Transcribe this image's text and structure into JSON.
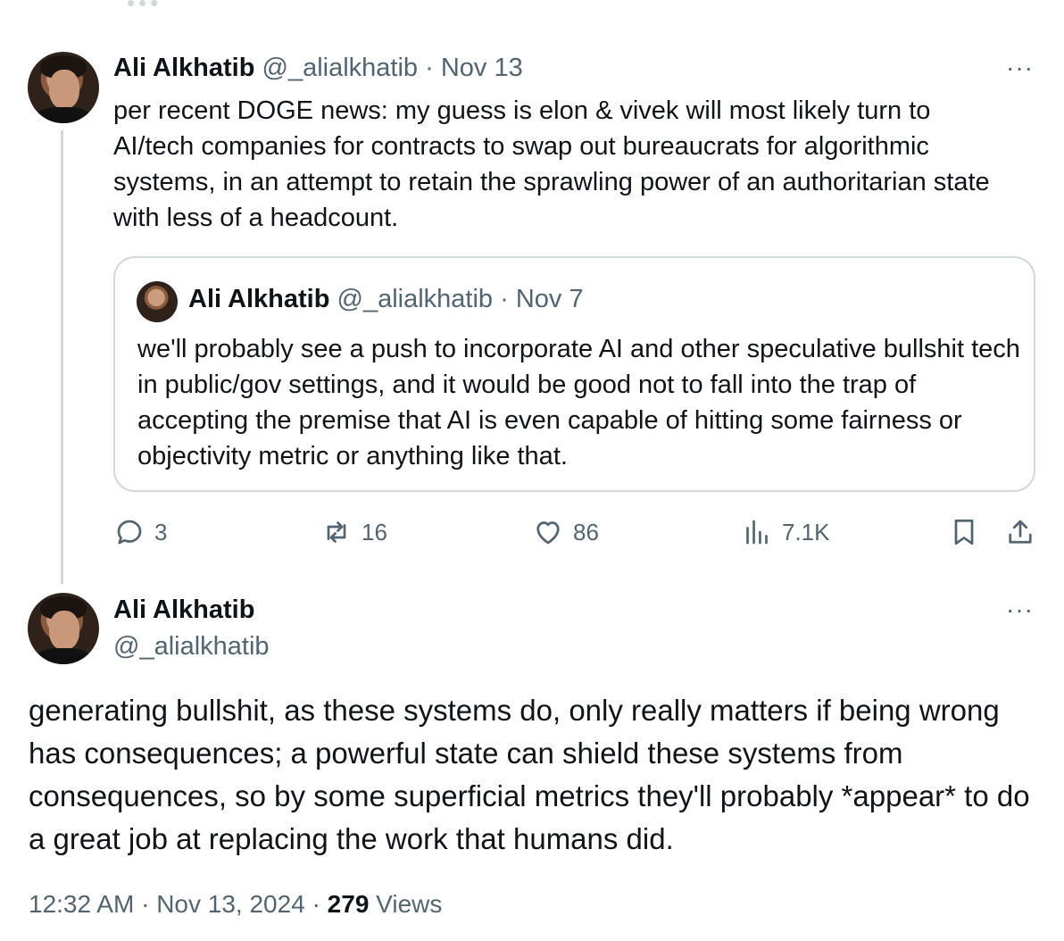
{
  "thread": {
    "first_tweet": {
      "name": "Ali Alkhatib",
      "handle": "@_alialkhatib",
      "separator": "·",
      "date": "Nov 13",
      "more": "···",
      "text": "per recent DOGE news: my guess is elon & vivek will most likely turn to AI/tech companies for contracts to swap out bureaucrats for algorithmic systems, in an attempt to retain the sprawling power of an authoritarian state with less of a headcount.",
      "quoted": {
        "name": "Ali Alkhatib",
        "handle": "@_alialkhatib",
        "separator": "·",
        "date": "Nov 7",
        "text": "we'll probably see a push to incorporate AI and other speculative bullshit tech in public/gov settings, and it would be good not to fall into the trap of accepting the premise that AI is even capable of hitting some fairness or objectivity metric or anything like that."
      },
      "actions": {
        "replies": "3",
        "reposts": "16",
        "likes": "86",
        "views": "7.1K"
      }
    },
    "main_tweet": {
      "name": "Ali Alkhatib",
      "handle": "@_alialkhatib",
      "more": "···",
      "text": "generating bullshit, as these systems do, only really matters if being wrong has consequences; a powerful state can shield these systems from consequences, so by some superficial metrics they'll probably *appear* to do a great job at replacing the work that humans did.",
      "time": "12:32 AM",
      "separator": "·",
      "date": "Nov 13, 2024",
      "views_count": "279",
      "views_label": "Views"
    }
  },
  "icons": {
    "reply": "reply-icon",
    "repost": "repost-icon",
    "like": "heart-icon",
    "views": "views-icon",
    "bookmark": "bookmark-icon",
    "share": "share-icon"
  },
  "colors": {
    "text": "#0f1419",
    "muted": "#536471",
    "border": "#cfd9de"
  }
}
